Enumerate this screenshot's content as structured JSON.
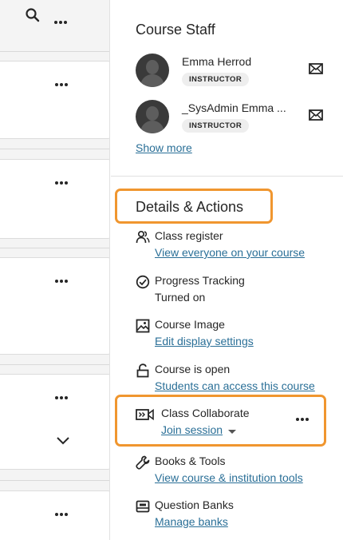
{
  "toolbar": {
    "search_icon": "search-icon",
    "more_icon": "more-horizontal-icon"
  },
  "course_staff": {
    "title": "Course Staff",
    "members": [
      {
        "name": "Emma Herrod",
        "role": "INSTRUCTOR"
      },
      {
        "name": "_SysAdmin Emma ...",
        "role": "INSTRUCTOR"
      }
    ],
    "show_more": "Show more"
  },
  "details_actions": {
    "title": "Details & Actions",
    "items": [
      {
        "title": "Class register",
        "subtitle": "View everyone on your course",
        "icon": "users-icon"
      },
      {
        "title": "Progress Tracking",
        "subtitle": "Turned on",
        "icon": "check-circle-icon"
      },
      {
        "title": "Course Image",
        "subtitle": "Edit display settings",
        "icon": "image-icon"
      },
      {
        "title": "Course is open",
        "subtitle": "Students can access this course",
        "icon": "unlock-icon"
      },
      {
        "title": "Class Collaborate",
        "subtitle": "Join session",
        "icon": "video-camera-icon"
      },
      {
        "title": "Books & Tools",
        "subtitle": "View course & institution tools",
        "icon": "wrench-icon"
      },
      {
        "title": "Question Banks",
        "subtitle": "Manage banks",
        "icon": "bank-icon"
      }
    ]
  },
  "highlight_color": "#f0962f",
  "link_color": "#2a6f97"
}
